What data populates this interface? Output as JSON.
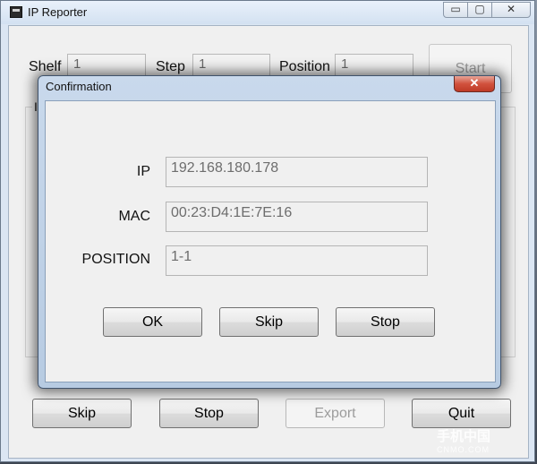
{
  "main": {
    "title": "IP Reporter",
    "controls": {
      "minimize": "▭",
      "maximize": "▢",
      "close": "✕"
    },
    "fields": {
      "shelf": {
        "label": "Shelf",
        "value": "1"
      },
      "step": {
        "label": "Step",
        "value": "1"
      },
      "position": {
        "label": "Position",
        "value": "1"
      }
    },
    "start_label": "Start",
    "group_label": "I",
    "buttons": {
      "skip": "Skip",
      "stop": "Stop",
      "export": "Export",
      "quit": "Quit"
    }
  },
  "dialog": {
    "title": "Confirmation",
    "close": "✕",
    "ip": {
      "label": "IP",
      "value": "192.168.180.178"
    },
    "mac": {
      "label": "MAC",
      "value": "00:23:D4:1E:7E:16"
    },
    "position": {
      "label": "POSITION",
      "value": "1-1"
    },
    "buttons": {
      "ok": "OK",
      "skip": "Skip",
      "stop": "Stop"
    }
  },
  "watermark": {
    "text": "手机中国",
    "sub": "CNMO.COM"
  }
}
